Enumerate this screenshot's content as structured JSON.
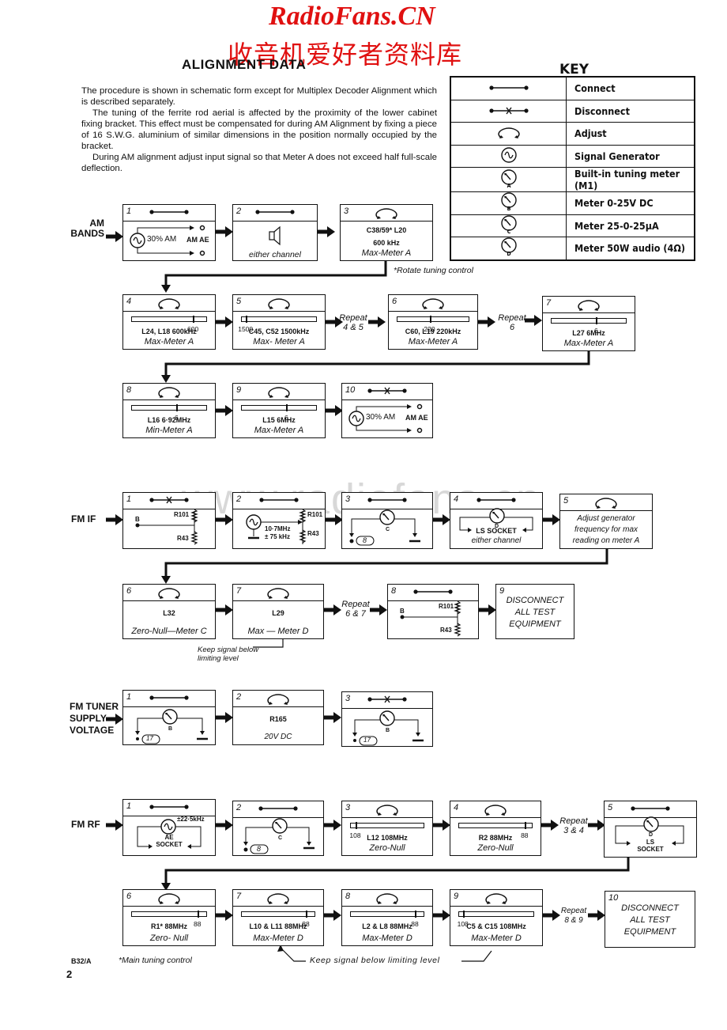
{
  "watermark": {
    "site": "RadioFans.CN",
    "chinese": "收音机爱好者资料库",
    "url": "www.radiofans.cn"
  },
  "title": "ALIGNMENT DATA",
  "intro": [
    "The procedure is shown in schematic form except for Multiplex Decoder Alignment which is described separately.",
    "The tuning of the ferrite rod aerial is affected by the proximity of the lower cabinet fixing bracket. This effect must be compensated for during AM Alignment by fixing a piece of 16 S.W.G. aluminium of similar dimensions in the position normally occupied by the bracket.",
    "During AM alignment adjust input signal so that Meter A does not exceed half full-scale deflection."
  ],
  "key": {
    "title": "KEY",
    "rows": [
      {
        "icon": "connect-icon",
        "label": "Connect"
      },
      {
        "icon": "disconnect-icon",
        "label": "Disconnect"
      },
      {
        "icon": "adjust-icon",
        "label": "Adjust"
      },
      {
        "icon": "signal-generator-icon",
        "label": "Signal Generator"
      },
      {
        "icon": "meter-a-icon",
        "meter": "A",
        "label": "Built-in tuning meter (M1)"
      },
      {
        "icon": "meter-b-icon",
        "meter": "B",
        "label": "Meter  0-25V  DC"
      },
      {
        "icon": "meter-c-icon",
        "meter": "C",
        "label": "Meter  25-0-25µA"
      },
      {
        "icon": "meter-d-icon",
        "meter": "D",
        "label": "Meter  50W audio (4Ω)"
      }
    ]
  },
  "am": {
    "label": [
      "AM",
      "BANDS"
    ],
    "steps": [
      {
        "n": "1",
        "action": "connect",
        "gen": "30% AM",
        "target": "AM AE"
      },
      {
        "n": "2",
        "action": "connect",
        "caption": "either channel"
      },
      {
        "n": "3",
        "action": "adjust",
        "line1": "C38/59*   L20",
        "line2": "600 kHz",
        "caption": "Max-Meter A"
      },
      {
        "n": "4",
        "action": "adjust",
        "scale_pos": 0.82,
        "scale_label": "600",
        "line1": "L24, L18   600kHz",
        "caption": "Max-Meter A"
      },
      {
        "n": "5",
        "action": "adjust",
        "scale_pos": 0.05,
        "scale_label": "1500",
        "line1": "C45, C52  1500kHz",
        "caption": "Max- Meter A"
      },
      {
        "n": "6",
        "action": "adjust",
        "scale_pos": 0.45,
        "scale_label": "220",
        "line1": "C60, L19  220kHz",
        "caption": "Max-Meter A"
      },
      {
        "n": "7",
        "action": "adjust",
        "scale_pos": 0.6,
        "scale_label": "6",
        "line1": "L27    6MHz",
        "caption": "Max-Meter A"
      },
      {
        "n": "8",
        "action": "adjust",
        "scale_pos": 0.6,
        "scale_label": "6",
        "line1": "L16  6·92MHz",
        "caption": "Min-Meter A"
      },
      {
        "n": "9",
        "action": "adjust",
        "scale_pos": 0.6,
        "scale_label": "6",
        "line1": "L15   6MHz",
        "caption": "Max-Meter A"
      },
      {
        "n": "10",
        "action": "disconnect",
        "gen": "30% AM",
        "target": "AM AE"
      }
    ],
    "repeat_a": [
      "Repeat",
      "4 & 5"
    ],
    "repeat_b": [
      "Repeat",
      "6"
    ],
    "footnote": "*Rotate tuning control"
  },
  "fmif": {
    "label": "FM IF",
    "steps": [
      {
        "n": "1",
        "action": "disconnect",
        "point": "B",
        "r1": "R101",
        "r2": "R43"
      },
      {
        "n": "2",
        "action": "connect",
        "freq": "10·7MHz",
        "dev": "± 75 kHz",
        "r1": "R101",
        "r2": "R43"
      },
      {
        "n": "3",
        "action": "connect",
        "meter": "C",
        "tp": "8"
      },
      {
        "n": "4",
        "action": "connect",
        "meter": "D",
        "socket": "LS SOCKET",
        "caption": "either channel"
      },
      {
        "n": "5",
        "action": "adjust",
        "lines": [
          "Adjust generator",
          "frequency for max",
          "reading on meter A"
        ]
      },
      {
        "n": "6",
        "action": "adjust",
        "line1": "L32",
        "caption": "Zero-Null—Meter C"
      },
      {
        "n": "7",
        "action": "adjust",
        "line1": "L29",
        "caption": "Max — Meter D"
      },
      {
        "n": "8",
        "action": "connect",
        "point": "B",
        "r1": "R101",
        "r2": "R43"
      },
      {
        "n": "9",
        "lines": [
          "DISCONNECT",
          "ALL  TEST",
          "EQUIPMENT"
        ]
      }
    ],
    "repeat": [
      "Repeat",
      "6 & 7"
    ],
    "note": [
      "Keep signal below",
      "limiting level"
    ]
  },
  "fmtuner": {
    "label": [
      "FM TUNER",
      "SUPPLY",
      "VOLTAGE"
    ],
    "steps": [
      {
        "n": "1",
        "action": "connect",
        "meter": "B",
        "tp": "17"
      },
      {
        "n": "2",
        "action": "adjust",
        "line1": "R165",
        "caption": "20V  DC"
      },
      {
        "n": "3",
        "action": "disconnect",
        "meter": "B",
        "tp": "17"
      }
    ]
  },
  "fmrf": {
    "label": "FM RF",
    "steps": [
      {
        "n": "1",
        "action": "connect",
        "dev": "±22·5kHz",
        "socket": [
          "AE",
          "SOCKET"
        ]
      },
      {
        "n": "2",
        "action": "connect",
        "meter": "C",
        "tp": "8"
      },
      {
        "n": "3",
        "action": "adjust",
        "scale_pos": 0.06,
        "scale_label": "108",
        "line1": "L12   108MHz",
        "caption": "Zero-Null"
      },
      {
        "n": "4",
        "action": "adjust",
        "scale_pos": 0.9,
        "scale_label": "88",
        "line1": "R2    88MHz",
        "caption": "Zero-Null"
      },
      {
        "n": "5",
        "action": "connect",
        "meter": "D",
        "socket": [
          "LS",
          "SOCKET"
        ]
      },
      {
        "n": "6",
        "action": "adjust",
        "scale_pos": 0.88,
        "scale_label": "88",
        "line1": "R1*      88MHz",
        "caption": "Zero- Null"
      },
      {
        "n": "7",
        "action": "adjust",
        "scale_pos": 0.88,
        "scale_label": "88",
        "line1": "L10 & L11  88MHz",
        "caption": "Max-Meter D"
      },
      {
        "n": "8",
        "action": "adjust",
        "scale_pos": 0.88,
        "scale_label": "88",
        "line1": "L2 & L8    88MHz",
        "caption": "Max-Meter D"
      },
      {
        "n": "9",
        "action": "adjust",
        "scale_pos": 0.05,
        "scale_label": "108",
        "line1": "C5 & C15   108MHz",
        "caption": "Max-Meter D"
      },
      {
        "n": "10",
        "lines": [
          "DISCONNECT",
          "ALL  TEST",
          "EQUIPMENT"
        ]
      }
    ],
    "repeat_a": [
      "Repeat",
      "3 & 4"
    ],
    "repeat_b": [
      "Repeat",
      "8 & 9"
    ],
    "note": "Keep  signal  below  limiting  level"
  },
  "footer": {
    "code": "B32/A",
    "footnote": "*Main tuning control",
    "page": "2"
  }
}
